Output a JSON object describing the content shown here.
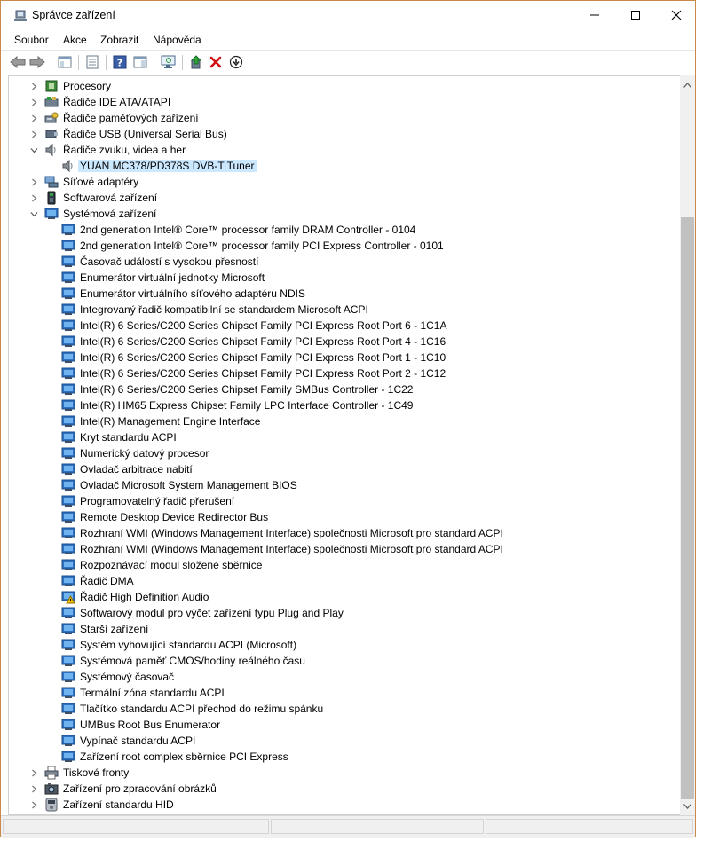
{
  "window": {
    "title": "Správce zařízení"
  },
  "menu": [
    "Soubor",
    "Akce",
    "Zobrazit",
    "Nápověda"
  ],
  "tree": [
    {
      "label": "Procesory",
      "level": 0,
      "expander": "collapsed",
      "icon": "processor-icon"
    },
    {
      "label": "Řadiče IDE ATA/ATAPI",
      "level": 0,
      "expander": "collapsed",
      "icon": "ide-controller-icon"
    },
    {
      "label": "Řadiče paměťových zařízení",
      "level": 0,
      "expander": "collapsed",
      "icon": "storage-controller-icon"
    },
    {
      "label": "Řadiče USB (Universal Serial Bus)",
      "level": 0,
      "expander": "collapsed",
      "icon": "usb-icon"
    },
    {
      "label": "Řadiče zvuku, videa a her",
      "level": 0,
      "expander": "expanded",
      "icon": "speaker-icon"
    },
    {
      "label": "YUAN MC378/PD378S DVB-T Tuner",
      "level": 1,
      "expander": "none",
      "icon": "speaker-icon",
      "selected": true
    },
    {
      "label": "Síťové adaptéry",
      "level": 0,
      "expander": "collapsed",
      "icon": "network-adapter-icon"
    },
    {
      "label": "Softwarová zařízení",
      "level": 0,
      "expander": "collapsed",
      "icon": "software-device-icon"
    },
    {
      "label": "Systémová zařízení",
      "level": 0,
      "expander": "expanded",
      "icon": "system-device-icon"
    },
    {
      "label": "2nd generation Intel® Core™ processor family DRAM Controller - 0104",
      "level": 1,
      "expander": "none",
      "icon": "system-device-icon"
    },
    {
      "label": "2nd generation Intel® Core™ processor family PCI Express Controller - 0101",
      "level": 1,
      "expander": "none",
      "icon": "system-device-icon"
    },
    {
      "label": "Časovač událostí s vysokou přesností",
      "level": 1,
      "expander": "none",
      "icon": "system-device-icon"
    },
    {
      "label": "Enumerátor virtuální jednotky Microsoft",
      "level": 1,
      "expander": "none",
      "icon": "system-device-icon"
    },
    {
      "label": "Enumerátor virtuálního síťového adaptéru NDIS",
      "level": 1,
      "expander": "none",
      "icon": "system-device-icon"
    },
    {
      "label": "Integrovaný řadič kompatibilní se standardem Microsoft ACPI",
      "level": 1,
      "expander": "none",
      "icon": "system-device-icon"
    },
    {
      "label": "Intel(R) 6 Series/C200 Series Chipset Family PCI Express Root Port 6 - 1C1A",
      "level": 1,
      "expander": "none",
      "icon": "system-device-icon"
    },
    {
      "label": "Intel(R) 6 Series/C200 Series Chipset Family PCI Express Root Port 4 - 1C16",
      "level": 1,
      "expander": "none",
      "icon": "system-device-icon"
    },
    {
      "label": "Intel(R) 6 Series/C200 Series Chipset Family PCI Express Root Port 1 - 1C10",
      "level": 1,
      "expander": "none",
      "icon": "system-device-icon"
    },
    {
      "label": "Intel(R) 6 Series/C200 Series Chipset Family PCI Express Root Port 2 - 1C12",
      "level": 1,
      "expander": "none",
      "icon": "system-device-icon"
    },
    {
      "label": "Intel(R) 6 Series/C200 Series Chipset Family SMBus Controller - 1C22",
      "level": 1,
      "expander": "none",
      "icon": "system-device-icon"
    },
    {
      "label": "Intel(R) HM65 Express Chipset Family LPC Interface Controller - 1C49",
      "level": 1,
      "expander": "none",
      "icon": "system-device-icon"
    },
    {
      "label": "Intel(R) Management Engine Interface",
      "level": 1,
      "expander": "none",
      "icon": "system-device-icon"
    },
    {
      "label": "Kryt standardu ACPI",
      "level": 1,
      "expander": "none",
      "icon": "system-device-icon"
    },
    {
      "label": "Numerický datový procesor",
      "level": 1,
      "expander": "none",
      "icon": "system-device-icon"
    },
    {
      "label": "Ovladač arbitrace nabití",
      "level": 1,
      "expander": "none",
      "icon": "system-device-icon"
    },
    {
      "label": "Ovladač Microsoft System Management BIOS",
      "level": 1,
      "expander": "none",
      "icon": "system-device-icon"
    },
    {
      "label": "Programovatelný řadič přerušení",
      "level": 1,
      "expander": "none",
      "icon": "system-device-icon"
    },
    {
      "label": "Remote Desktop Device Redirector Bus",
      "level": 1,
      "expander": "none",
      "icon": "system-device-icon"
    },
    {
      "label": "Rozhraní WMI (Windows Management Interface) společnosti Microsoft pro standard ACPI",
      "level": 1,
      "expander": "none",
      "icon": "system-device-icon"
    },
    {
      "label": "Rozhraní WMI (Windows Management Interface) společnosti Microsoft pro standard ACPI",
      "level": 1,
      "expander": "none",
      "icon": "system-device-icon"
    },
    {
      "label": "Rozpoznávací modul složené sběrnice",
      "level": 1,
      "expander": "none",
      "icon": "system-device-icon"
    },
    {
      "label": "Řadič DMA",
      "level": 1,
      "expander": "none",
      "icon": "system-device-icon"
    },
    {
      "label": "Řadič High Definition Audio",
      "level": 1,
      "expander": "none",
      "icon": "warning-device-icon"
    },
    {
      "label": "Softwarový modul pro výčet zařízení typu Plug and Play",
      "level": 1,
      "expander": "none",
      "icon": "system-device-icon"
    },
    {
      "label": "Starší zařízení",
      "level": 1,
      "expander": "none",
      "icon": "system-device-icon"
    },
    {
      "label": "Systém vyhovující standardu ACPI (Microsoft)",
      "level": 1,
      "expander": "none",
      "icon": "system-device-icon"
    },
    {
      "label": "Systémová paměť CMOS/hodiny reálného času",
      "level": 1,
      "expander": "none",
      "icon": "system-device-icon"
    },
    {
      "label": "Systémový časovač",
      "level": 1,
      "expander": "none",
      "icon": "system-device-icon"
    },
    {
      "label": "Termální zóna standardu ACPI",
      "level": 1,
      "expander": "none",
      "icon": "system-device-icon"
    },
    {
      "label": "Tlačítko standardu ACPI přechod do režimu spánku",
      "level": 1,
      "expander": "none",
      "icon": "system-device-icon"
    },
    {
      "label": "UMBus Root Bus Enumerator",
      "level": 1,
      "expander": "none",
      "icon": "system-device-icon"
    },
    {
      "label": "Vypínač standardu ACPI",
      "level": 1,
      "expander": "none",
      "icon": "system-device-icon"
    },
    {
      "label": "Zařízení root complex sběrnice PCI Express",
      "level": 1,
      "expander": "none",
      "icon": "system-device-icon"
    },
    {
      "label": "Tiskové fronty",
      "level": 0,
      "expander": "collapsed",
      "icon": "printer-icon"
    },
    {
      "label": "Zařízení pro zpracování obrázků",
      "level": 0,
      "expander": "collapsed",
      "icon": "camera-icon"
    },
    {
      "label": "Zařízení standardu HID",
      "level": 0,
      "expander": "collapsed",
      "icon": "hid-icon"
    }
  ],
  "colors": {
    "selection": "#cce8ff",
    "window_border": "#c88a4a",
    "remove_red": "#d01010"
  }
}
